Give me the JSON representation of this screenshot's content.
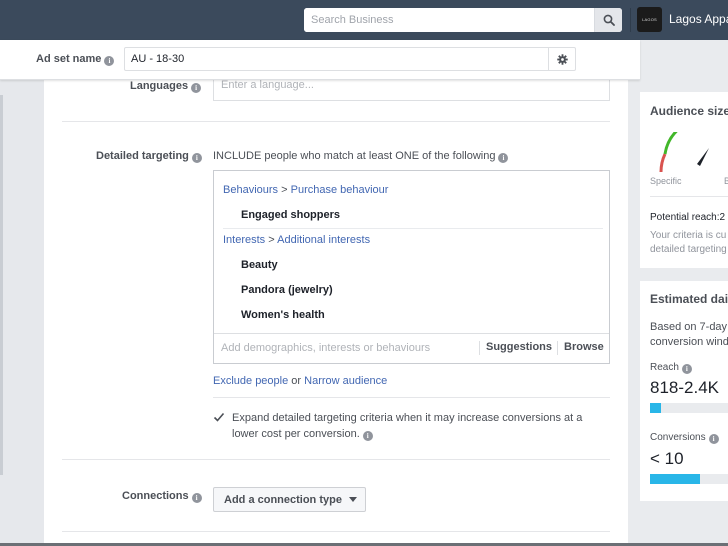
{
  "topbar": {
    "search_placeholder": "Search Business",
    "business_logo_text": "LAGOS",
    "business_name": "Lagos Apparel"
  },
  "adset": {
    "label": "Ad set name",
    "value": "AU - 18-30"
  },
  "languages": {
    "label": "Languages",
    "placeholder": "Enter a language..."
  },
  "detailed_targeting": {
    "label": "Detailed targeting",
    "header": "INCLUDE people who match at least ONE of the following",
    "groups": [
      {
        "category": "Behaviours",
        "subcategory": "Purchase behaviour",
        "items": [
          "Engaged shoppers"
        ]
      },
      {
        "category": "Interests",
        "subcategory": "Additional interests",
        "items": [
          "Beauty",
          "Pandora (jewelry)",
          "Women's health"
        ]
      }
    ],
    "crumb_separator": ">",
    "input_placeholder": "Add demographics, interests or behaviours",
    "suggestions_label": "Suggestions",
    "browse_label": "Browse",
    "exclude_link": "Exclude people",
    "or_text": "or",
    "narrow_link": "Narrow audience",
    "expand_checked": true,
    "expand_text": "Expand detailed targeting criteria when it may increase conversions at a lower cost per conversion."
  },
  "connections": {
    "label": "Connections",
    "button_label": "Add a connection type"
  },
  "audience_size": {
    "title": "Audience size",
    "gauge_left_label": "Specific",
    "gauge_right_label": "Broad",
    "potential_reach_label": "Potential reach:2",
    "criteria_text_1": "Your criteria is cu",
    "criteria_text_2": "detailed targeting"
  },
  "estimated_daily": {
    "title": "Estimated daily results",
    "description_1": "Based on 7-day",
    "description_2": "conversion window",
    "reach_label": "Reach",
    "reach_value": "818-2.4K",
    "reach_fill_fraction": 0.14,
    "conversions_label": "Conversions",
    "conversions_value": "< 10",
    "conversions_fill_fraction": 0.64
  },
  "colors": {
    "topbar": "#3b4a5c",
    "link": "#4267b2",
    "bar_fill": "#29b6e8",
    "gauge_green": "#42b72a",
    "gauge_red": "#d9534f"
  }
}
